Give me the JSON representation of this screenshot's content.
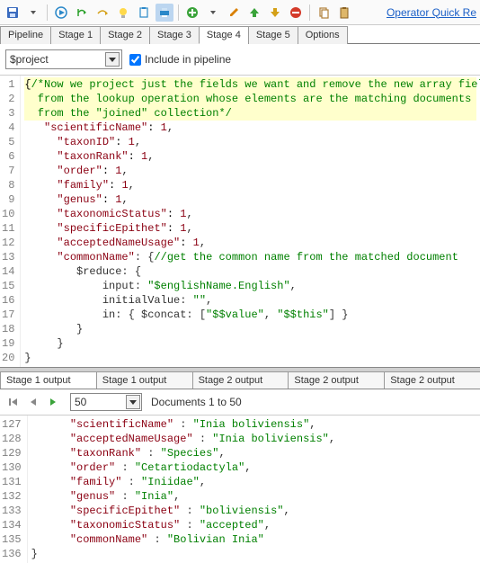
{
  "toolbar": {
    "quick_ref_link": "Operator Quick Re"
  },
  "tabs": [
    "Pipeline",
    "Stage 1",
    "Stage 2",
    "Stage 3",
    "Stage 4",
    "Stage 5",
    "Options"
  ],
  "activeTab": 4,
  "stage": {
    "operator": "$project",
    "include_label": "Include in pipeline",
    "include_checked": true
  },
  "code_lines": [
    {
      "n": 1,
      "cls": "comment-bg",
      "segs": [
        [
          "{",
          "c-punc"
        ],
        [
          "/*Now we project just the fields we want and remove the new array field",
          "c-green"
        ]
      ]
    },
    {
      "n": 2,
      "cls": "comment-bg",
      "segs": [
        [
          "  from the lookup operation whose elements are the matching documents",
          "c-green"
        ]
      ]
    },
    {
      "n": 3,
      "cls": "comment-bg",
      "segs": [
        [
          "  from the \"joined\" collection*/",
          "c-green"
        ]
      ]
    },
    {
      "n": 4,
      "segs": [
        [
          "   ",
          ""
        ],
        [
          "\"scientificName\"",
          "c-key"
        ],
        [
          ": ",
          "c-punc"
        ],
        [
          "1",
          "c-num"
        ],
        [
          ",",
          ""
        ]
      ]
    },
    {
      "n": 5,
      "segs": [
        [
          "     ",
          ""
        ],
        [
          "\"taxonID\"",
          "c-key"
        ],
        [
          ": ",
          "c-punc"
        ],
        [
          "1",
          "c-num"
        ],
        [
          ",",
          ""
        ]
      ]
    },
    {
      "n": 6,
      "segs": [
        [
          "     ",
          ""
        ],
        [
          "\"taxonRank\"",
          "c-key"
        ],
        [
          ": ",
          "c-punc"
        ],
        [
          "1",
          "c-num"
        ],
        [
          ",",
          ""
        ]
      ]
    },
    {
      "n": 7,
      "segs": [
        [
          "     ",
          ""
        ],
        [
          "\"order\"",
          "c-key"
        ],
        [
          ": ",
          "c-punc"
        ],
        [
          "1",
          "c-num"
        ],
        [
          ",",
          ""
        ]
      ]
    },
    {
      "n": 8,
      "segs": [
        [
          "     ",
          ""
        ],
        [
          "\"family\"",
          "c-key"
        ],
        [
          ": ",
          "c-punc"
        ],
        [
          "1",
          "c-num"
        ],
        [
          ",",
          ""
        ]
      ]
    },
    {
      "n": 9,
      "segs": [
        [
          "     ",
          ""
        ],
        [
          "\"genus\"",
          "c-key"
        ],
        [
          ": ",
          "c-punc"
        ],
        [
          "1",
          "c-num"
        ],
        [
          ",",
          ""
        ]
      ]
    },
    {
      "n": 10,
      "segs": [
        [
          "     ",
          ""
        ],
        [
          "\"taxonomicStatus\"",
          "c-key"
        ],
        [
          ": ",
          "c-punc"
        ],
        [
          "1",
          "c-num"
        ],
        [
          ",",
          ""
        ]
      ]
    },
    {
      "n": 11,
      "segs": [
        [
          "     ",
          ""
        ],
        [
          "\"specificEpithet\"",
          "c-key"
        ],
        [
          ": ",
          "c-punc"
        ],
        [
          "1",
          "c-num"
        ],
        [
          ",",
          ""
        ]
      ]
    },
    {
      "n": 12,
      "segs": [
        [
          "     ",
          ""
        ],
        [
          "\"acceptedNameUsage\"",
          "c-key"
        ],
        [
          ": ",
          "c-punc"
        ],
        [
          "1",
          "c-num"
        ],
        [
          ",",
          ""
        ]
      ]
    },
    {
      "n": 13,
      "segs": [
        [
          "     ",
          ""
        ],
        [
          "\"commonName\"",
          "c-key"
        ],
        [
          ": {",
          ""
        ],
        [
          "//get the common name from the matched document",
          "c-green"
        ]
      ]
    },
    {
      "n": 14,
      "segs": [
        [
          "        $reduce: {",
          ""
        ]
      ]
    },
    {
      "n": 15,
      "segs": [
        [
          "            input: ",
          ""
        ],
        [
          "\"$englishName.English\"",
          "c-str"
        ],
        [
          ",",
          ""
        ]
      ]
    },
    {
      "n": 16,
      "segs": [
        [
          "            initialValue: ",
          ""
        ],
        [
          "\"\"",
          "c-str"
        ],
        [
          ",",
          ""
        ]
      ]
    },
    {
      "n": 17,
      "segs": [
        [
          "            in: { $concat: [",
          ""
        ],
        [
          "\"$$value\"",
          "c-str"
        ],
        [
          ", ",
          ""
        ],
        [
          "\"$$this\"",
          "c-str"
        ],
        [
          "] }",
          ""
        ]
      ]
    },
    {
      "n": 18,
      "segs": [
        [
          "        }",
          ""
        ]
      ]
    },
    {
      "n": 19,
      "segs": [
        [
          "     }",
          ""
        ]
      ]
    },
    {
      "n": 20,
      "segs": [
        [
          "}",
          ""
        ]
      ]
    }
  ],
  "output_tabs": [
    "Stage 1 output",
    "Stage 1 output",
    "Stage 2 output",
    "Stage 2 output",
    "Stage 2 output"
  ],
  "nav": {
    "page_size": "50",
    "doc_label": "Documents 1 to 50"
  },
  "output_lines": [
    {
      "n": 127,
      "segs": [
        [
          "      ",
          ""
        ],
        [
          "\"scientificName\"",
          "c-okey"
        ],
        [
          " : ",
          ""
        ],
        [
          "\"Inia boliviensis\"",
          "c-oval"
        ],
        [
          ",",
          ""
        ]
      ]
    },
    {
      "n": 128,
      "segs": [
        [
          "      ",
          ""
        ],
        [
          "\"acceptedNameUsage\"",
          "c-okey"
        ],
        [
          " : ",
          ""
        ],
        [
          "\"Inia boliviensis\"",
          "c-oval"
        ],
        [
          ",",
          ""
        ]
      ]
    },
    {
      "n": 129,
      "segs": [
        [
          "      ",
          ""
        ],
        [
          "\"taxonRank\"",
          "c-okey"
        ],
        [
          " : ",
          ""
        ],
        [
          "\"Species\"",
          "c-oval"
        ],
        [
          ",",
          ""
        ]
      ]
    },
    {
      "n": 130,
      "segs": [
        [
          "      ",
          ""
        ],
        [
          "\"order\"",
          "c-okey"
        ],
        [
          " : ",
          ""
        ],
        [
          "\"Cetartiodactyla\"",
          "c-oval"
        ],
        [
          ",",
          ""
        ]
      ]
    },
    {
      "n": 131,
      "segs": [
        [
          "      ",
          ""
        ],
        [
          "\"family\"",
          "c-okey"
        ],
        [
          " : ",
          ""
        ],
        [
          "\"Iniidae\"",
          "c-oval"
        ],
        [
          ",",
          ""
        ]
      ]
    },
    {
      "n": 132,
      "segs": [
        [
          "      ",
          ""
        ],
        [
          "\"genus\"",
          "c-okey"
        ],
        [
          " : ",
          ""
        ],
        [
          "\"Inia\"",
          "c-oval"
        ],
        [
          ",",
          ""
        ]
      ]
    },
    {
      "n": 133,
      "segs": [
        [
          "      ",
          ""
        ],
        [
          "\"specificEpithet\"",
          "c-okey"
        ],
        [
          " : ",
          ""
        ],
        [
          "\"boliviensis\"",
          "c-oval"
        ],
        [
          ",",
          ""
        ]
      ]
    },
    {
      "n": 134,
      "segs": [
        [
          "      ",
          ""
        ],
        [
          "\"taxonomicStatus\"",
          "c-okey"
        ],
        [
          " : ",
          ""
        ],
        [
          "\"accepted\"",
          "c-oval"
        ],
        [
          ",",
          ""
        ]
      ]
    },
    {
      "n": 135,
      "segs": [
        [
          "      ",
          ""
        ],
        [
          "\"commonName\"",
          "c-okey"
        ],
        [
          " : ",
          ""
        ],
        [
          "\"Bolivian Inia\"",
          "c-oval"
        ]
      ]
    },
    {
      "n": 136,
      "segs": [
        [
          "}",
          ""
        ]
      ]
    }
  ]
}
